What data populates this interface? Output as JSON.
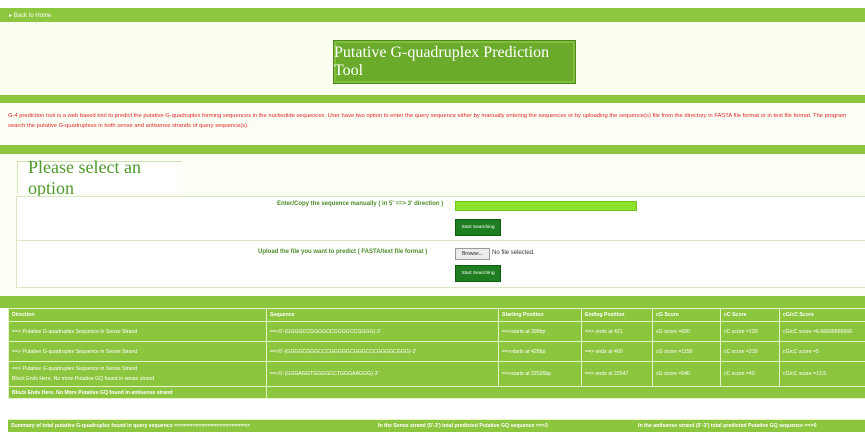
{
  "nav": {
    "back_link": "Back to Home",
    "back_icon": "play-icon"
  },
  "header": {
    "title": "Putative G-quadruplex Prediction Tool"
  },
  "description": "G-4 prediction tool is a web based tool to predict the putative G-quadruplex forming sequences in the nucleotide sequences. User have two option to enter the query sequence either by manually entering the sequences or by uploading the sequence(s) file from the directory in FASTA file format or in text file format. The program search the putative G-quadruplexs in both sense and antisense strands of query sequence(s).",
  "options": {
    "title": "Please select an option",
    "manual_label": "Enter/Copy the sequence manually ( in 5' ==> 3' direction )",
    "manual_value": "",
    "search_button": "Start Searching",
    "upload_label": "Upload the file you want to predict ( FASTA/text file format )",
    "browse_button": "Browse...",
    "no_file": "No file selected.",
    "search_button2": "Start Searching"
  },
  "results": {
    "columns": [
      "Direction",
      "Sequence",
      "Starting Position",
      "Ending Position",
      "cG Score",
      "cC Score",
      "cG/cC Score"
    ],
    "rows": [
      [
        "==> Putative G-quadruplex Sequence in Sense Strand",
        "==>5'-(GGGGCCGGGGCCGGGGCCGGGG)-3'",
        "==>starts at 399bp",
        "==> ends at 421",
        "cG score =600",
        "cC score =120",
        "cG/cC score =6.66666666666"
      ],
      [
        "==> Putative G-quadruplex Sequence in Sense Strand",
        "==>5'-(GGGGCGGGCCCGGGGGCGGGCCCGGGGCGGG)-3'",
        "==>starts at 428bp",
        "==> ends at 460",
        "cG score =1150",
        "cC score =230",
        "cG/cC score =5"
      ],
      [
        "==> Putative G-quadruplex Sequence in Sense Strand",
        "==>5'-(GGGAGGTGGGGCCTGGGAAGGG)-3'",
        "==>starts at 22526bp",
        "==> ends at 22547",
        "cG score =540",
        "cC score =40",
        "cG/cC score =13.5"
      ]
    ],
    "sense_end": "Block Ends Here. No more Putative GQ found in sense strand",
    "antisense_end": "Block Ends Here. No More Putative GQ found in antisense strand"
  },
  "summary": {
    "total": "Summary of total putative G-quadruplex found in query sequence ========================>",
    "sense": "In the Sense strand (5'-3') total predicted Putative GQ sequence ==>3",
    "antisense": "In the antisense strand (5'-3') total predicted Putative GQ sequence ==>0"
  },
  "colors": {
    "green_bar": "#8cc63f",
    "title_box": "#6aab2b",
    "desc_text": "#e3262b",
    "button": "#1e7d1e",
    "input": "#8fe22b"
  }
}
